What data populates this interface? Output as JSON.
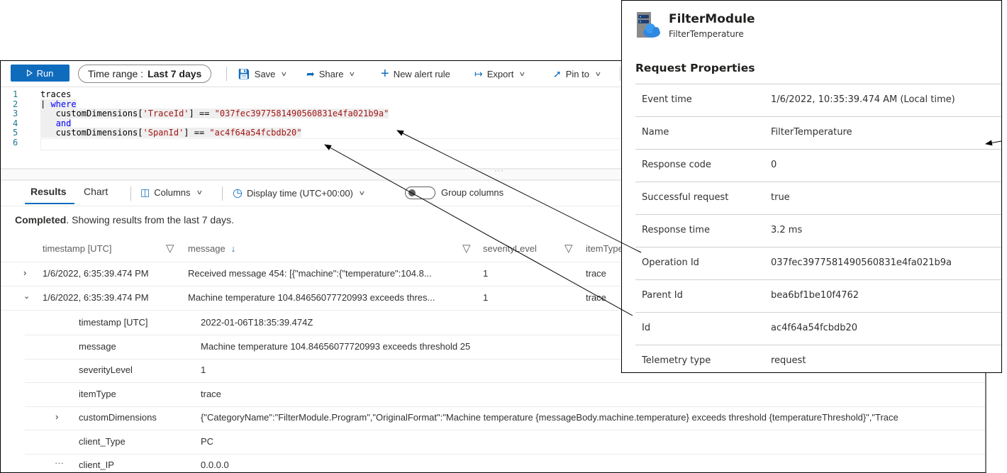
{
  "toolbar": {
    "run_label": "Run",
    "time_range_label": "Time range :",
    "time_range_value": "Last 7 days",
    "save_label": "Save",
    "share_label": "Share",
    "new_alert_label": "New alert rule",
    "export_label": "Export",
    "pin_label": "Pin to"
  },
  "editor": {
    "lines": [
      {
        "num": "1",
        "parts": [
          {
            "t": "traces",
            "c": "plain"
          }
        ]
      },
      {
        "num": "2",
        "parts": [
          {
            "t": "| ",
            "c": "plain"
          },
          {
            "t": "where",
            "c": "kw"
          }
        ]
      },
      {
        "num": "3",
        "parts": [
          {
            "t": "   customDimensions[",
            "c": "plain"
          },
          {
            "t": "'TraceId'",
            "c": "str"
          },
          {
            "t": "] == ",
            "c": "plain"
          },
          {
            "t": "\"037fec3977581490560831e4fa021b9a\"",
            "c": "str"
          }
        ]
      },
      {
        "num": "4",
        "parts": [
          {
            "t": "   ",
            "c": "plain"
          },
          {
            "t": "and",
            "c": "kw"
          }
        ]
      },
      {
        "num": "5",
        "parts": [
          {
            "t": "   customDimensions[",
            "c": "plain"
          },
          {
            "t": "'SpanId'",
            "c": "str"
          },
          {
            "t": "] == ",
            "c": "plain"
          },
          {
            "t": "\"ac4f64a54fcbdb20\"",
            "c": "str"
          }
        ]
      },
      {
        "num": "6",
        "parts": []
      }
    ]
  },
  "results": {
    "tab_results": "Results",
    "tab_chart": "Chart",
    "columns_label": "Columns",
    "display_time_label": "Display time (UTC+00:00)",
    "group_columns_label": "Group columns",
    "group_columns_on": false,
    "status_bold": "Completed",
    "status_rest": ". Showing results from the last 7 days.",
    "columns": [
      "timestamp [UTC]",
      "message",
      "severityLevel",
      "itemType"
    ],
    "rows": [
      {
        "expanded": false,
        "timestamp": "1/6/2022, 6:35:39.474 PM",
        "message": "Received message 454: [{\"machine\":{\"temperature\":104.8...",
        "severityLevel": "1",
        "itemType": "trace"
      },
      {
        "expanded": true,
        "timestamp": "1/6/2022, 6:35:39.474 PM",
        "message": "Machine temperature 104.84656077720993 exceeds thres...",
        "severityLevel": "1",
        "itemType": "trace"
      }
    ],
    "details": [
      {
        "key": "timestamp [UTC]",
        "value": "2022-01-06T18:35:39.474Z"
      },
      {
        "key": "message",
        "value": "Machine temperature 104.84656077720993 exceeds threshold 25"
      },
      {
        "key": "severityLevel",
        "value": "1"
      },
      {
        "key": "itemType",
        "value": "trace"
      },
      {
        "key": "customDimensions",
        "value": "{\"CategoryName\":\"FilterModule.Program\",\"OriginalFormat\":\"Machine temperature {messageBody.machine.temperature} exceeds threshold {temperatureThreshold}\",\"Trace",
        "expandable": true
      },
      {
        "key": "client_Type",
        "value": "PC"
      },
      {
        "key": "client_IP",
        "value": "0.0.0.0",
        "more": true
      }
    ]
  },
  "properties": {
    "title": "FilterModule",
    "subtitle": "FilterTemperature",
    "section": "Request Properties",
    "rows": [
      {
        "key": "Event time",
        "value": "1/6/2022, 10:35:39.474 AM (Local time)"
      },
      {
        "key": "Name",
        "value": "FilterTemperature"
      },
      {
        "key": "Response code",
        "value": "0"
      },
      {
        "key": "Successful request",
        "value": "true"
      },
      {
        "key": "Response time",
        "value": "3.2 ms"
      },
      {
        "key": "Operation Id",
        "value": "037fec3977581490560831e4fa021b9a"
      },
      {
        "key": "Parent Id",
        "value": "bea6bf1be10f4762"
      },
      {
        "key": "Id",
        "value": "ac4f64a54fcbdb20"
      },
      {
        "key": "Telemetry type",
        "value": "request"
      }
    ]
  },
  "colors": {
    "accent": "#0f6cbd",
    "keyword": "#0000ff",
    "string": "#a31515"
  }
}
